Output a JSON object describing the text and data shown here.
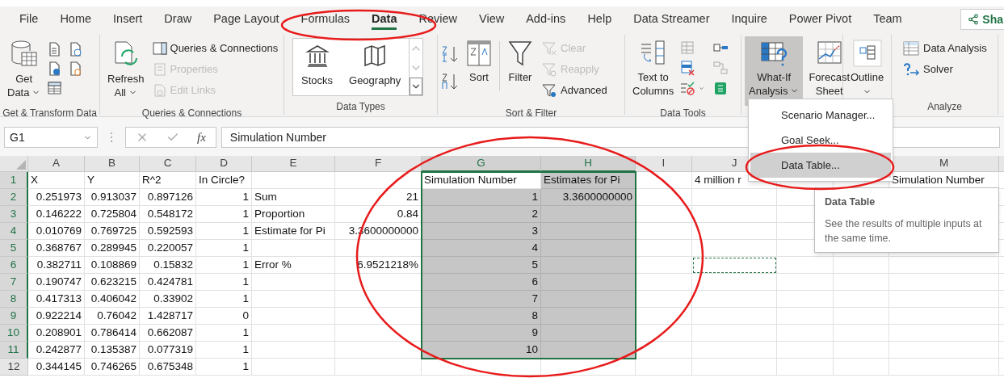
{
  "tabs": [
    {
      "label": "File",
      "selected": false
    },
    {
      "label": "Home",
      "selected": false
    },
    {
      "label": "Insert",
      "selected": false
    },
    {
      "label": "Draw",
      "selected": false
    },
    {
      "label": "Page Layout",
      "selected": false
    },
    {
      "label": "Formulas",
      "selected": false
    },
    {
      "label": "Data",
      "selected": true
    },
    {
      "label": "Review",
      "selected": false
    },
    {
      "label": "View",
      "selected": false
    },
    {
      "label": "Add-ins",
      "selected": false
    },
    {
      "label": "Help",
      "selected": false
    },
    {
      "label": "Data Streamer",
      "selected": false
    },
    {
      "label": "Inquire",
      "selected": false
    },
    {
      "label": "Power Pivot",
      "selected": false
    },
    {
      "label": "Team",
      "selected": false
    }
  ],
  "share_button": "Sha",
  "ribbon": [
    {
      "label": "Get & Transform Data",
      "buttons": [
        {
          "kind": "large",
          "lines": [
            "Get",
            "Data"
          ],
          "caret": true,
          "pressed": false
        }
      ]
    },
    {
      "label": "Queries & Connections",
      "buttons": [
        {
          "kind": "large",
          "lines": [
            "Refresh",
            "All"
          ],
          "caret": true,
          "pressed": false
        },
        {
          "kind": "small",
          "label": "Queries & Connections",
          "disabled": false
        },
        {
          "kind": "small",
          "label": "Properties",
          "disabled": true
        },
        {
          "kind": "small",
          "label": "Edit Links",
          "disabled": true
        }
      ]
    },
    {
      "label": "Data Types",
      "buttons": [
        {
          "kind": "gallery",
          "label": "Stocks"
        },
        {
          "kind": "gallery",
          "label": "Geography"
        }
      ]
    },
    {
      "label": "Sort & Filter",
      "buttons": [
        {
          "kind": "large",
          "lines": [
            "Sort"
          ],
          "caret": false,
          "pressed": false
        },
        {
          "kind": "large",
          "lines": [
            "Filter"
          ],
          "caret": false,
          "pressed": false
        },
        {
          "kind": "small",
          "label": "Clear",
          "disabled": true
        },
        {
          "kind": "small",
          "label": "Reapply",
          "disabled": true
        },
        {
          "kind": "small",
          "label": "Advanced",
          "disabled": false
        }
      ]
    },
    {
      "label": "Data Tools",
      "buttons": [
        {
          "kind": "large",
          "lines": [
            "Text to",
            "Columns"
          ],
          "caret": false,
          "pressed": false
        }
      ]
    },
    {
      "buttons": [
        {
          "kind": "large",
          "lines": [
            "What-If",
            "Analysis"
          ],
          "caret": true,
          "pressed": true
        },
        {
          "kind": "large",
          "lines": [
            "Forecast",
            "Sheet"
          ],
          "caret": false,
          "pressed": false
        }
      ]
    },
    {
      "buttons": [
        {
          "kind": "large",
          "lines": [
            "Outline"
          ],
          "caret": true,
          "pressed": false
        }
      ]
    },
    {
      "label": "Analyze",
      "buttons": [
        {
          "kind": "small",
          "label": "Data Analysis",
          "disabled": false
        },
        {
          "kind": "small",
          "label": "Solver",
          "disabled": false
        }
      ]
    }
  ],
  "formula_bar": {
    "name_box": "G1",
    "function_button": "fx",
    "formula": "Simulation Number"
  },
  "sheet": {
    "columns": [
      {
        "label": "A",
        "selected": false
      },
      {
        "label": "B",
        "selected": false
      },
      {
        "label": "C",
        "selected": false
      },
      {
        "label": "D",
        "selected": false
      },
      {
        "label": "E",
        "selected": false
      },
      {
        "label": "F",
        "selected": false
      },
      {
        "label": "G",
        "selected": true
      },
      {
        "label": "H",
        "selected": true
      },
      {
        "label": "I",
        "selected": false
      },
      {
        "label": "J",
        "selected": false
      },
      null,
      null,
      {
        "label": "M",
        "selected": false
      }
    ],
    "rows": [
      {
        "label": "1",
        "selected": true,
        "cells": [
          {
            "text": "X",
            "kind": "text"
          },
          {
            "text": "Y",
            "kind": "text"
          },
          {
            "text": "R^2",
            "kind": "text"
          },
          {
            "text": "In Circle?",
            "kind": "text"
          },
          null,
          null,
          {
            "text": "Simulation Number",
            "kind": "text",
            "active": true
          },
          {
            "text": "Estimates for Pi",
            "kind": "text",
            "selected": true
          },
          null,
          {
            "text": "4 million r",
            "kind": "text"
          },
          null,
          null,
          {
            "text": "Simulation Number",
            "kind": "text"
          }
        ]
      },
      {
        "label": "2",
        "selected": true,
        "cells": [
          {
            "text": "0.251973",
            "kind": "number"
          },
          {
            "text": "0.913037",
            "kind": "number"
          },
          {
            "text": "0.897126",
            "kind": "number"
          },
          {
            "text": "1",
            "kind": "number"
          },
          {
            "text": "Sum",
            "kind": "text"
          },
          {
            "text": "21",
            "kind": "number"
          },
          {
            "text": "1",
            "kind": "number",
            "selected": true
          },
          {
            "text": "3.3600000000",
            "kind": "number",
            "selected": true
          }
        ]
      },
      {
        "label": "3",
        "selected": true,
        "cells": [
          {
            "text": "0.146222",
            "kind": "number"
          },
          {
            "text": "0.725804",
            "kind": "number"
          },
          {
            "text": "0.548172",
            "kind": "number"
          },
          {
            "text": "1",
            "kind": "number"
          },
          {
            "text": "Proportion",
            "kind": "text"
          },
          {
            "text": "0.84",
            "kind": "number"
          },
          {
            "text": "2",
            "kind": "number",
            "selected": true
          },
          {
            "kind": "empty",
            "selected": true
          }
        ]
      },
      {
        "label": "4",
        "selected": true,
        "cells": [
          {
            "text": "0.010769",
            "kind": "number"
          },
          {
            "text": "0.769725",
            "kind": "number"
          },
          {
            "text": "0.592593",
            "kind": "number"
          },
          {
            "text": "1",
            "kind": "number"
          },
          {
            "text": "Estimate for Pi",
            "kind": "text"
          },
          {
            "text": "3.3600000000",
            "kind": "number"
          },
          {
            "text": "3",
            "kind": "number",
            "selected": true
          },
          {
            "kind": "empty",
            "selected": true
          }
        ]
      },
      {
        "label": "5",
        "selected": true,
        "cells": [
          {
            "text": "0.368767",
            "kind": "number"
          },
          {
            "text": "0.289945",
            "kind": "number"
          },
          {
            "text": "0.220057",
            "kind": "number"
          },
          {
            "text": "1",
            "kind": "number"
          },
          null,
          null,
          {
            "text": "4",
            "kind": "number",
            "selected": true
          },
          {
            "kind": "empty",
            "selected": true
          }
        ]
      },
      {
        "label": "6",
        "selected": true,
        "cells": [
          {
            "text": "0.382711",
            "kind": "number"
          },
          {
            "text": "0.108869",
            "kind": "number"
          },
          {
            "text": "0.15832",
            "kind": "number"
          },
          {
            "text": "1",
            "kind": "number"
          },
          {
            "text": "Error %",
            "kind": "text"
          },
          {
            "text": "6.9521218%",
            "kind": "number"
          },
          {
            "text": "5",
            "kind": "number",
            "selected": true
          },
          {
            "kind": "empty",
            "selected": true
          },
          null,
          {
            "kind": "empty",
            "copied": true
          }
        ]
      },
      {
        "label": "7",
        "selected": true,
        "cells": [
          {
            "text": "0.190747",
            "kind": "number"
          },
          {
            "text": "0.623215",
            "kind": "number"
          },
          {
            "text": "0.424781",
            "kind": "number"
          },
          {
            "text": "1",
            "kind": "number"
          },
          null,
          null,
          {
            "text": "6",
            "kind": "number",
            "selected": true
          },
          {
            "kind": "empty",
            "selected": true
          }
        ]
      },
      {
        "label": "8",
        "selected": true,
        "cells": [
          {
            "text": "0.417313",
            "kind": "number"
          },
          {
            "text": "0.406042",
            "kind": "number"
          },
          {
            "text": "0.33902",
            "kind": "number"
          },
          {
            "text": "1",
            "kind": "number"
          },
          null,
          null,
          {
            "text": "7",
            "kind": "number",
            "selected": true
          },
          {
            "kind": "empty",
            "selected": true
          }
        ]
      },
      {
        "label": "9",
        "selected": true,
        "cells": [
          {
            "text": "0.922214",
            "kind": "number"
          },
          {
            "text": "0.76042",
            "kind": "number"
          },
          {
            "text": "1.428717",
            "kind": "number"
          },
          {
            "text": "0",
            "kind": "number"
          },
          null,
          null,
          {
            "text": "8",
            "kind": "number",
            "selected": true
          },
          {
            "kind": "empty",
            "selected": true
          }
        ]
      },
      {
        "label": "10",
        "selected": true,
        "cells": [
          {
            "text": "0.208901",
            "kind": "number"
          },
          {
            "text": "0.786414",
            "kind": "number"
          },
          {
            "text": "0.662087",
            "kind": "number"
          },
          {
            "text": "1",
            "kind": "number"
          },
          null,
          null,
          {
            "text": "9",
            "kind": "number",
            "selected": true
          },
          {
            "kind": "empty",
            "selected": true
          }
        ]
      },
      {
        "label": "11",
        "selected": true,
        "cells": [
          {
            "text": "0.242877",
            "kind": "number"
          },
          {
            "text": "0.135387",
            "kind": "number"
          },
          {
            "text": "0.077319",
            "kind": "number"
          },
          {
            "text": "1",
            "kind": "number"
          },
          null,
          null,
          {
            "text": "10",
            "kind": "number",
            "selected": true
          },
          {
            "kind": "empty",
            "selected": true
          }
        ]
      },
      {
        "label": "12",
        "selected": false,
        "cells": [
          {
            "text": "0.344145",
            "kind": "number"
          },
          {
            "text": "0.746265",
            "kind": "number"
          },
          {
            "text": "0.675348",
            "kind": "number"
          },
          {
            "text": "1",
            "kind": "number"
          }
        ]
      }
    ]
  },
  "menu": {
    "items": [
      {
        "label": "Scenario Manager...",
        "selected": false
      },
      {
        "label": "Goal Seek...",
        "selected": false
      },
      {
        "label": "Data Table...",
        "selected": true
      }
    ]
  },
  "tooltip": {
    "title": "Data Table",
    "text": "See the results of multiple inputs at the same time."
  }
}
